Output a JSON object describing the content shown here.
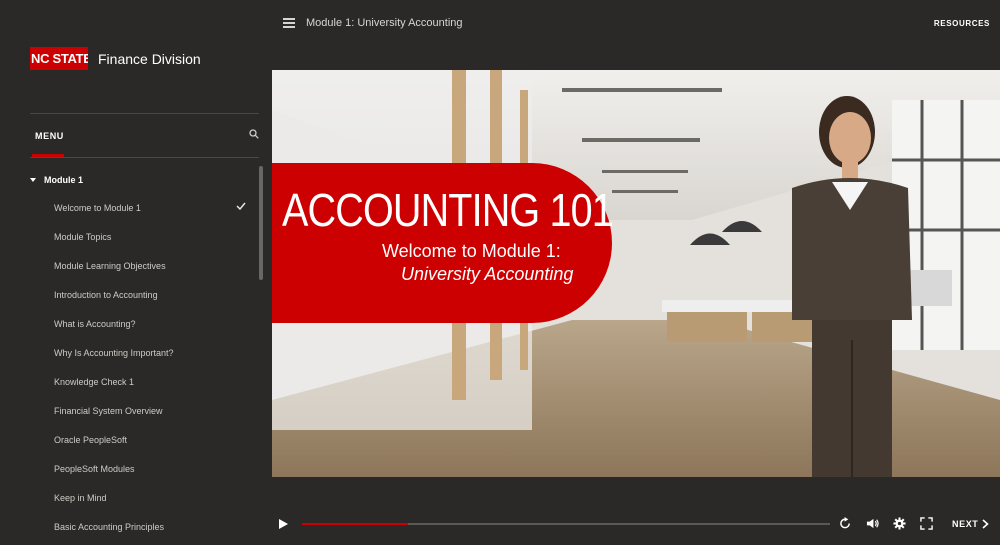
{
  "brand": {
    "logo_text": "NC STATE",
    "division": "Finance Division"
  },
  "header": {
    "module_title": "Module 1: University Accounting",
    "resources_label": "RESOURCES"
  },
  "menu": {
    "label": "MENU",
    "module_label": "Module 1",
    "items": [
      {
        "label": "Welcome to Module 1",
        "completed": true
      },
      {
        "label": "Module Topics"
      },
      {
        "label": "Module Learning Objectives"
      },
      {
        "label": "Introduction to Accounting"
      },
      {
        "label": "What is Accounting?"
      },
      {
        "label": "Why Is Accounting Important?"
      },
      {
        "label": "Knowledge Check 1"
      },
      {
        "label": "Financial System Overview"
      },
      {
        "label": "Oracle PeopleSoft"
      },
      {
        "label": "PeopleSoft Modules"
      },
      {
        "label": "Keep in Mind"
      },
      {
        "label": "Basic Accounting Principles"
      }
    ]
  },
  "slide": {
    "title": "ACCOUNTING 101",
    "subtitle_line1": "Welcome to Module 1:",
    "subtitle_line2": "University Accounting"
  },
  "player": {
    "progress": 0.2,
    "next_label": "NEXT"
  },
  "colors": {
    "accent": "#cc0000",
    "background": "#2b2927"
  },
  "icons": [
    "hamburger-icon",
    "search-icon",
    "check-icon",
    "play-icon",
    "replay-icon",
    "volume-icon",
    "settings-icon",
    "fullscreen-icon",
    "chevron-right-icon"
  ]
}
